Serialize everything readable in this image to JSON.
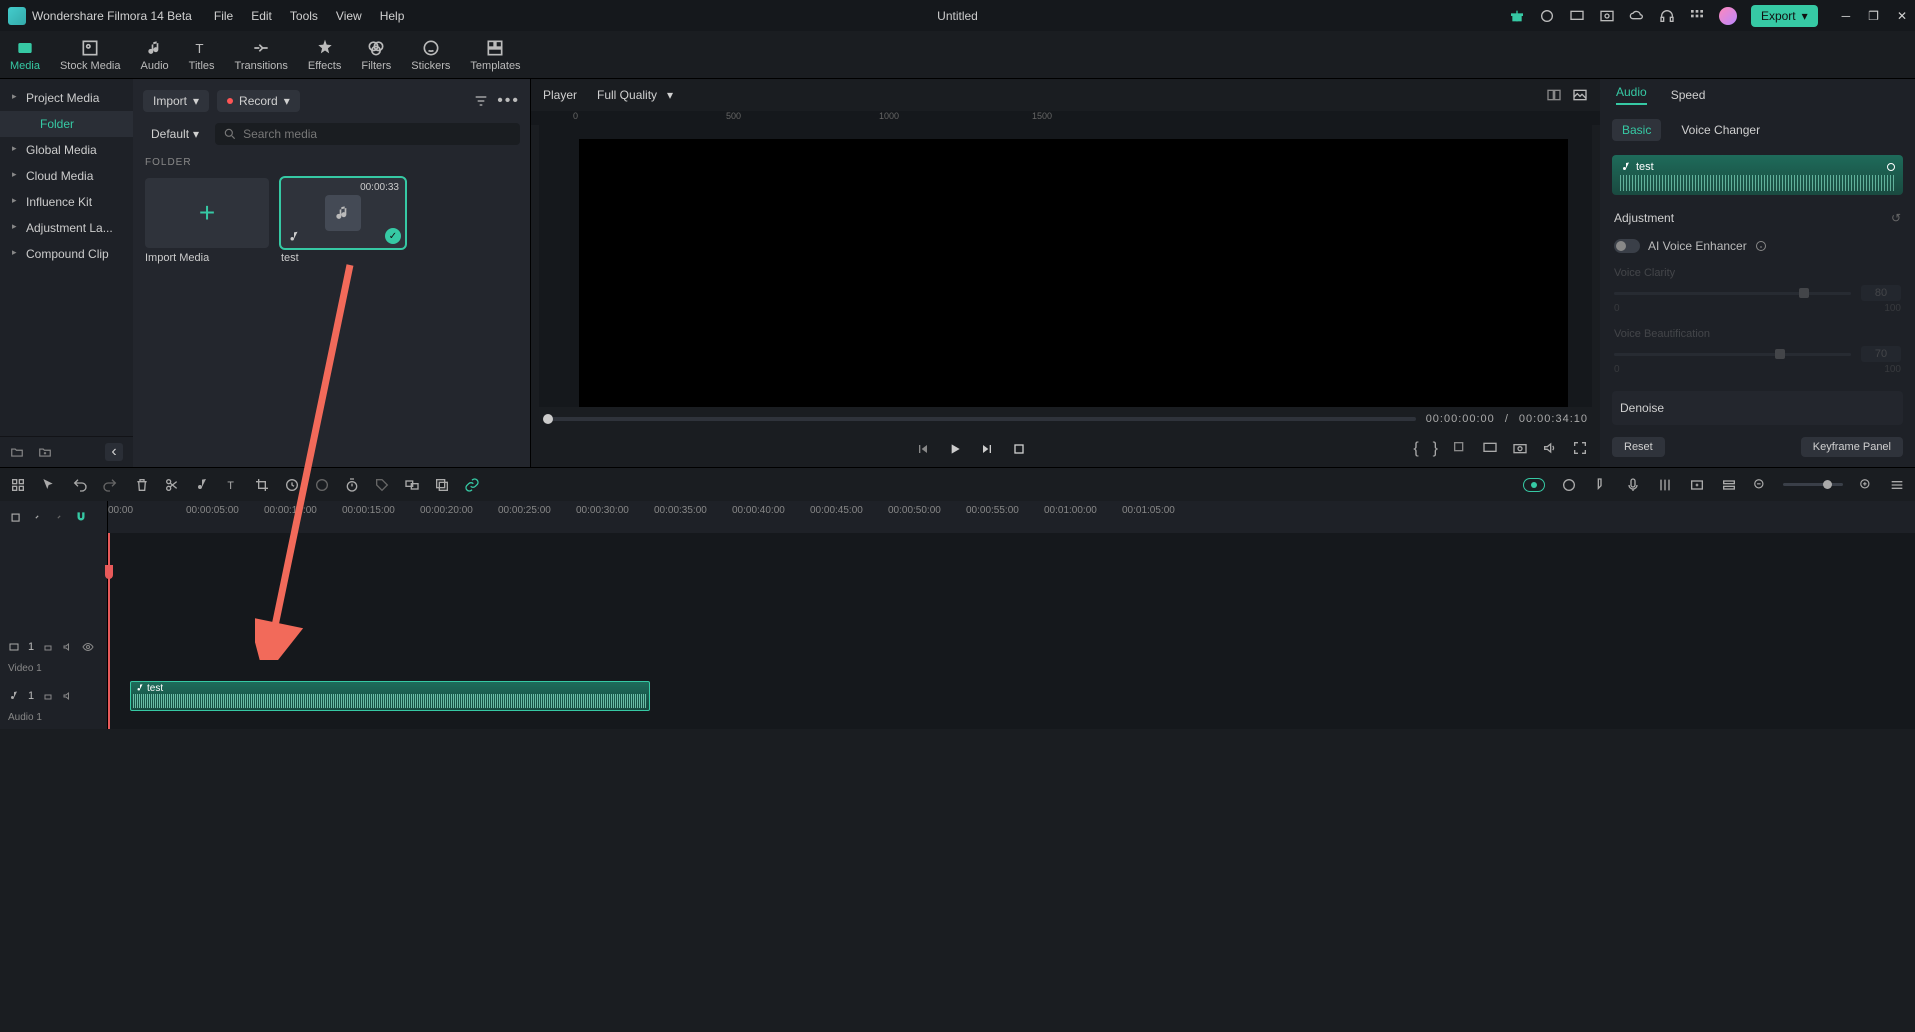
{
  "app": {
    "title": "Wondershare Filmora 14 Beta",
    "doc_title": "Untitled",
    "export": "Export"
  },
  "menus": [
    "File",
    "Edit",
    "Tools",
    "View",
    "Help"
  ],
  "top_tabs": [
    "Media",
    "Stock Media",
    "Audio",
    "Titles",
    "Transitions",
    "Effects",
    "Filters",
    "Stickers",
    "Templates"
  ],
  "sidebar": {
    "items": [
      "Project Media",
      "Folder",
      "Global Media",
      "Cloud Media",
      "Influence Kit",
      "Adjustment La...",
      "Compound Clip"
    ]
  },
  "media_panel": {
    "import": "Import",
    "record": "Record",
    "sort": "Default",
    "search_placeholder": "Search media",
    "section": "FOLDER",
    "cards": {
      "import_label": "Import Media",
      "test_label": "test",
      "test_duration": "00:00:33"
    }
  },
  "preview": {
    "player": "Player",
    "quality": "Full Quality",
    "ruler_vals": [
      "0",
      "500",
      "1000",
      "1500"
    ],
    "time_current": "00:00:00:00",
    "time_sep": "/",
    "time_total": "00:00:34:10"
  },
  "inspector": {
    "tabs": [
      "Audio",
      "Speed"
    ],
    "subtabs": [
      "Basic",
      "Voice Changer"
    ],
    "chip_label": "test",
    "adjustment": "Adjustment",
    "ai_label": "AI Voice Enhancer",
    "clarity": {
      "label": "Voice Clarity",
      "val": "80",
      "min": "0",
      "max": "100",
      "pct": 80
    },
    "beaut": {
      "label": "Voice Beautification",
      "val": "70",
      "min": "0",
      "max": "100",
      "pct": 70
    },
    "denoise": "Denoise",
    "reset": "Reset",
    "keyframe": "Keyframe Panel"
  },
  "timeline": {
    "ticks": [
      "00:00",
      "00:00:05:00",
      "00:00:10:00",
      "00:00:15:00",
      "00:00:20:00",
      "00:00:25:00",
      "00:00:30:00",
      "00:00:35:00",
      "00:00:40:00",
      "00:00:45:00",
      "00:00:50:00",
      "00:00:55:00",
      "00:01:00:00",
      "00:01:05:00"
    ],
    "video_track": "Video 1",
    "audio_track": "Audio 1",
    "clip_label": "test"
  }
}
